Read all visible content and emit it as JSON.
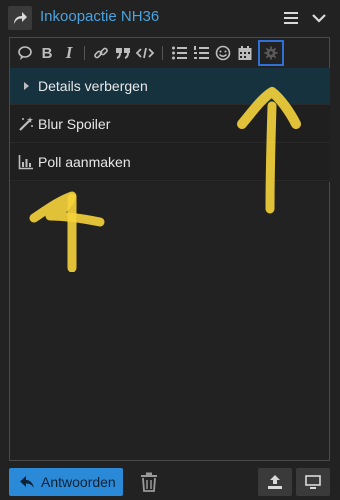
{
  "header": {
    "title": "Inkoopactie NH36",
    "share_icon": "share-arrow-icon",
    "menu_icon": "hamburger-icon",
    "collapse_icon": "chevron-down-icon"
  },
  "toolbar": {
    "icons": [
      "quote-bubble-icon",
      "bold-icon",
      "italic-icon",
      "link-icon",
      "blockquote-icon",
      "code-icon",
      "bullet-list-icon",
      "numbered-list-icon",
      "emoji-icon",
      "calendar-icon",
      "gear-icon"
    ],
    "bold_glyph": "B",
    "italic_glyph": "I",
    "highlight_color": "#2f6fd6"
  },
  "menu": {
    "items": [
      {
        "label": "Details verbergen",
        "icon": "caret-right-icon"
      },
      {
        "label": "Blur Spoiler",
        "icon": "magic-wand-icon"
      },
      {
        "label": "Poll aanmaken",
        "icon": "bar-chart-icon"
      }
    ]
  },
  "footer": {
    "reply_label": "Antwoorden",
    "reply_color": "#2b8ad8"
  },
  "colors": {
    "accent": "#4aa3df",
    "arrow_yellow": "#f5d33a"
  }
}
